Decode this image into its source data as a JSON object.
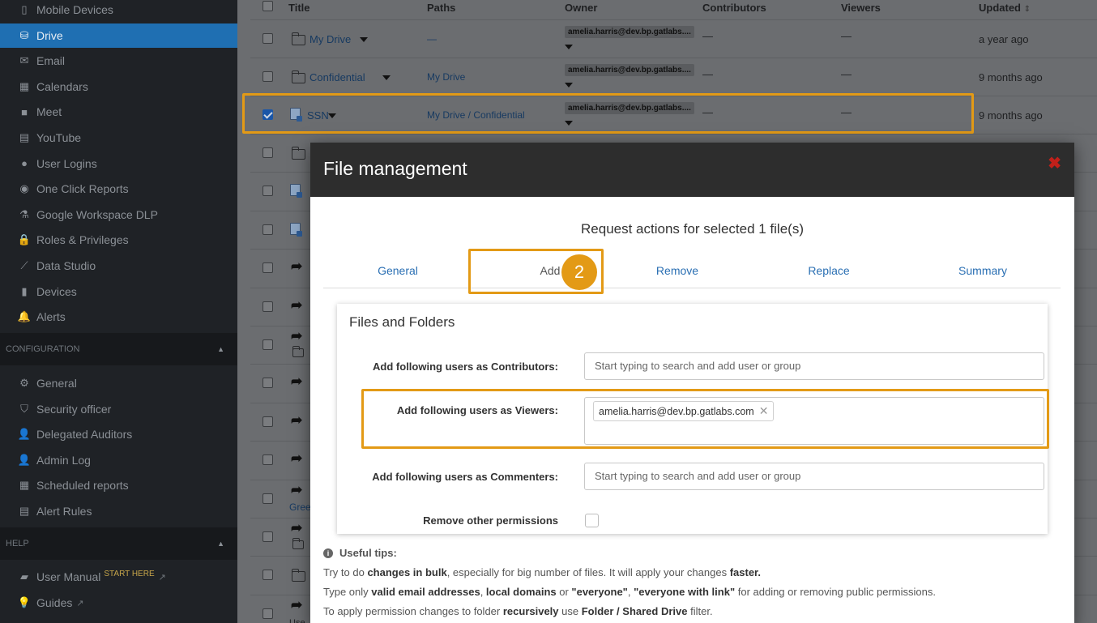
{
  "sidebar": {
    "items_top": [
      {
        "label": "Mobile Devices",
        "icon": "mobile-icon",
        "glyph": "▯"
      },
      {
        "label": "Drive",
        "icon": "drive-icon",
        "glyph": "⛁",
        "active": true
      },
      {
        "label": "Email",
        "icon": "email-icon",
        "glyph": "✉"
      },
      {
        "label": "Calendars",
        "icon": "calendar-icon",
        "glyph": "▦"
      },
      {
        "label": "Meet",
        "icon": "video-icon",
        "glyph": "■"
      },
      {
        "label": "YouTube",
        "icon": "film-icon",
        "glyph": "▤"
      },
      {
        "label": "User Logins",
        "icon": "globe-icon",
        "glyph": "●"
      },
      {
        "label": "One Click Reports",
        "icon": "eye-icon",
        "glyph": "◉"
      },
      {
        "label": "Google Workspace DLP",
        "icon": "flask-icon",
        "glyph": "⚗"
      },
      {
        "label": "Roles & Privileges",
        "icon": "lock-icon",
        "glyph": "🔒"
      },
      {
        "label": "Data Studio",
        "icon": "chart-icon",
        "glyph": "⟋"
      },
      {
        "label": "Devices",
        "icon": "devices-icon",
        "glyph": "▮"
      },
      {
        "label": "Alerts",
        "icon": "bell-icon",
        "glyph": "🔔"
      }
    ],
    "section_config": "CONFIGURATION",
    "items_config": [
      {
        "label": "General",
        "icon": "gears-icon",
        "glyph": "⚙"
      },
      {
        "label": "Security officer",
        "icon": "shield-icon",
        "glyph": "⛉"
      },
      {
        "label": "Delegated Auditors",
        "icon": "user-lock-icon",
        "glyph": "👤"
      },
      {
        "label": "Admin Log",
        "icon": "user-star-icon",
        "glyph": "👤"
      },
      {
        "label": "Scheduled reports",
        "icon": "calendar-icon",
        "glyph": "▦"
      },
      {
        "label": "Alert Rules",
        "icon": "document-icon",
        "glyph": "▤"
      }
    ],
    "section_help": "HELP",
    "items_help": [
      {
        "label": "User Manual",
        "icon": "book-icon",
        "glyph": "▰",
        "badge": "START HERE"
      },
      {
        "label": "Guides",
        "icon": "lightbulb-icon",
        "glyph": "💡"
      }
    ]
  },
  "table": {
    "headers": {
      "title": "Title",
      "paths": "Paths",
      "owner": "Owner",
      "contributors": "Contributors",
      "viewers": "Viewers",
      "updated": "Updated"
    },
    "sort_icon": "⇕",
    "rows": [
      {
        "title": "My Drive",
        "path": "—",
        "owner": "amelia.harris@dev.bp.gatlabs....",
        "contributors": "—",
        "viewers": "—",
        "updated": "a year ago",
        "icon": "folder",
        "checked": false
      },
      {
        "title": "Confidential",
        "path": "My Drive",
        "owner": "amelia.harris@dev.bp.gatlabs....",
        "contributors": "—",
        "viewers": "—",
        "updated": "9 months ago",
        "icon": "folder",
        "checked": false
      },
      {
        "title": "SSN",
        "path": "My Drive / Confidential",
        "owner": "amelia.harris@dev.bp.gatlabs....",
        "contributors": "—",
        "viewers": "—",
        "updated": "9 months ago",
        "icon": "file",
        "checked": true
      }
    ],
    "partial_labels": {
      "gree": "Gree",
      "use": "Use"
    }
  },
  "modal": {
    "title": "File management",
    "close_glyph": "✖",
    "subtitle": "Request actions for selected 1 file(s)",
    "tabs": [
      "General",
      "Add",
      "Remove",
      "Replace",
      "Summary"
    ],
    "step_badge": "2",
    "panel_title": "Files and Folders",
    "contributors_label": "Add following users as Contributors:",
    "contributors_placeholder": "Start typing to search and add user or group",
    "viewers_label": "Add following users as Viewers:",
    "viewer_tag": "amelia.harris@dev.bp.gatlabs.com",
    "tag_remove": "✕",
    "commenters_label": "Add following users as Commenters:",
    "commenters_placeholder": "Start typing to search and add user or group",
    "remove_perms_label": "Remove other permissions",
    "tips": {
      "title": "Useful tips:",
      "line1": [
        "Try to do ",
        "changes in bulk",
        ", especially for big number of files. It will apply your changes ",
        "faster."
      ],
      "line2": [
        "Type only ",
        "valid email addresses",
        ", ",
        "local domains",
        " or ",
        "\"everyone\"",
        ", ",
        "\"everyone with link\"",
        " for adding or removing public permissions."
      ],
      "line3": [
        "To apply permission changes to folder ",
        "recursively",
        " use ",
        "Folder / Shared Drive",
        " filter."
      ]
    }
  }
}
